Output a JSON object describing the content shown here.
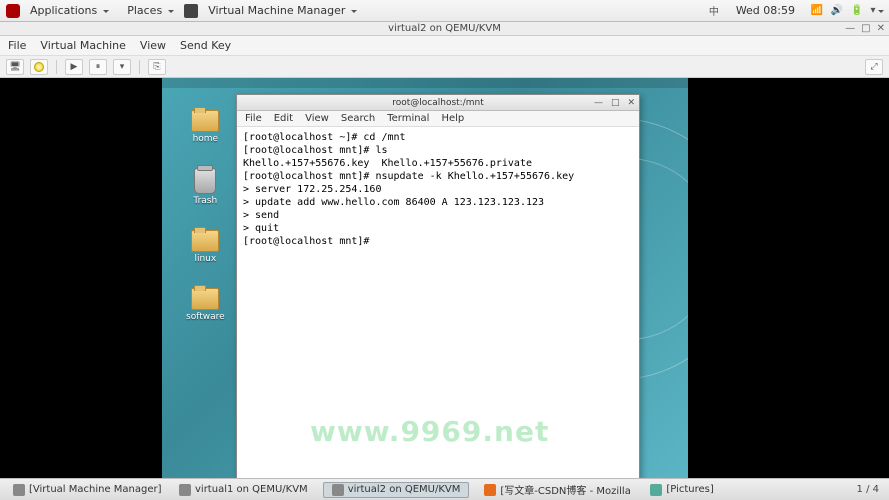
{
  "top_panel": {
    "apps": "Applications",
    "places": "Places",
    "active_app": "Virtual Machine Manager",
    "lang": "中",
    "clock": "Wed 08:59"
  },
  "vmm": {
    "title": "virtual2 on QEMU/KVM",
    "menu": {
      "file": "File",
      "vm": "Virtual Machine",
      "view": "View",
      "sendkey": "Send Key"
    }
  },
  "guest": {
    "icons": {
      "home": "home",
      "trash": "Trash",
      "linux": "linux",
      "software": "software"
    },
    "terminal": {
      "title": "root@localhost:/mnt",
      "menu": {
        "file": "File",
        "edit": "Edit",
        "view": "View",
        "search": "Search",
        "terminal": "Terminal",
        "help": "Help"
      },
      "lines": [
        "[root@localhost ~]# cd /mnt",
        "[root@localhost mnt]# ls",
        "Khello.+157+55676.key  Khello.+157+55676.private",
        "[root@localhost mnt]# nsupdate -k Khello.+157+55676.key",
        "> server 172.25.254.160",
        "> update add www.hello.com 86400 A 123.123.123.123",
        "> send",
        "> quit",
        "[root@localhost mnt]# "
      ]
    }
  },
  "watermark": "www.9969.net",
  "taskbar": {
    "items": [
      "[Virtual Machine Manager]",
      "virtual1 on QEMU/KVM",
      "virtual2 on QEMU/KVM",
      "[写文章-CSDN博客 - Mozilla Firef...",
      "[Pictures]"
    ],
    "pager": "1 / 4"
  }
}
